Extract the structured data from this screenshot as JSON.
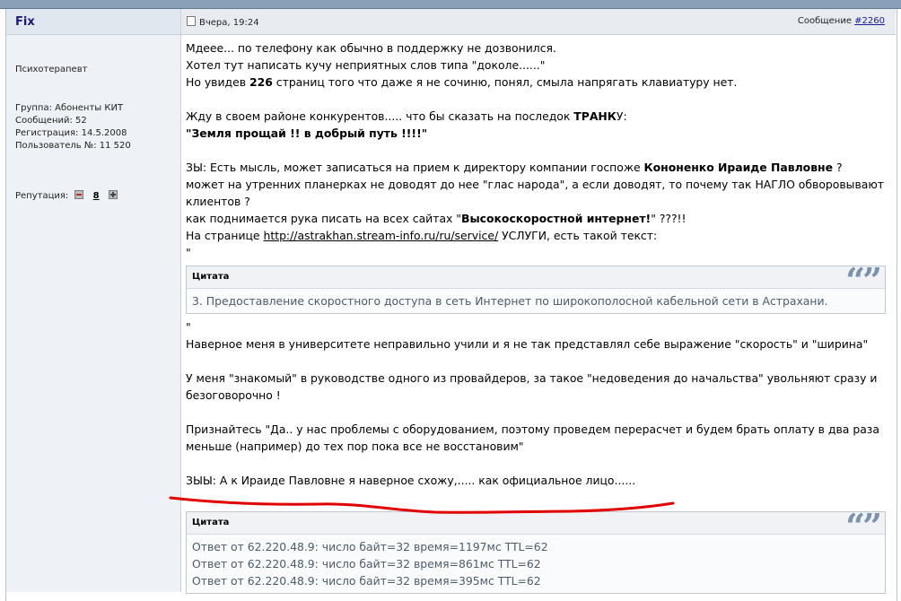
{
  "user": {
    "name": "Fix",
    "rank": "Психотерапевт",
    "group": "Группа: Абоненты КИТ",
    "messages": "Сообщений: 52",
    "registration": "Регистрация: 14.5.2008",
    "user_number": "Пользователь №: 11 520",
    "reputation_label": "Репутация:",
    "reputation_value": "8"
  },
  "post": {
    "date": "Вчера, 19:24",
    "message_label": "Сообщение ",
    "message_number": "#2260",
    "lines": {
      "l1": "Мдеее... по телефону как обычно в поддержку не дозвонился.",
      "l2": "Хотел тут написать кучу неприятных слов типа \"доколе......\"",
      "l3a": "Но увидев ",
      "l3b": "226",
      "l3c": " страниц того что даже я не сочиню, понял, смыла напрягать клавиатуру нет.",
      "l4a": "Жду в своем районе конкурентов..... что бы сказать на последок ",
      "l4b": "ТРАНК",
      "l4c": "У:",
      "l5": "\"Земля прощай !! в добрый путь !!!!\"",
      "l6a": "ЗЫ: Есть мысль, может записаться на прием к директору компании госпоже ",
      "l6b": "Кононенко Ираиде Павловне",
      "l6c": " ?",
      "l7": "может на утренних планерках не доводят до нее \"глас народа\", а если доводят, то почему так НАГЛО обворовывают",
      "l8": "клиентов ?",
      "l9a": "как поднимается рука писать на всех сайтах \"",
      "l9b": "Высокоскоростной интернет!",
      "l9c": "\" ???!!",
      "l10a": "На странице ",
      "l10b": "http://astrakhan.stream-info.ru/ru/service/",
      "l10c": " УСЛУГИ, есть такой текст:",
      "l11": "\"",
      "l12": "\"",
      "l13": "Наверное меня в университете неправильно учили и я не так представлял себе выражение \"скорость\" и \"ширина\"",
      "l14": "У меня \"знакомый\" в руководстве одного из провайдеров, за такое \"недоведения до начальства\" увольняют сразу и",
      "l15": "безоговорочно !",
      "l16": "Признайтесь \"Да.. у нас проблемы с оборудованием, поэтому проведем перерасчет и будем брать оплату в два раза",
      "l17": "меньше (например) до тех пор пока все не восстановим\"",
      "l18": "ЗЫЫ: А к Ираиде Павловне я наверное схожу,..... как официальное лицо......"
    },
    "quote1": {
      "title": "Цитата",
      "text": "3. Предоставление скоростного доступа в сеть Интернет по широкополосной кабельной сети в Астрахани."
    },
    "quote2": {
      "title": "Цитата",
      "lines": [
        "Ответ от 62.220.48.9: число байт=32 время=1197мс TTL=62",
        "Ответ от 62.220.48.9: число байт=32 время=861мс TTL=62",
        "Ответ от 62.220.48.9: число байт=32 время=395мс TTL=62"
      ]
    },
    "quote_mark": "“”"
  },
  "colors": {
    "accent": "#1a1a7a",
    "quote_text": "#4d5b6a",
    "red_mark": "#e00000"
  }
}
